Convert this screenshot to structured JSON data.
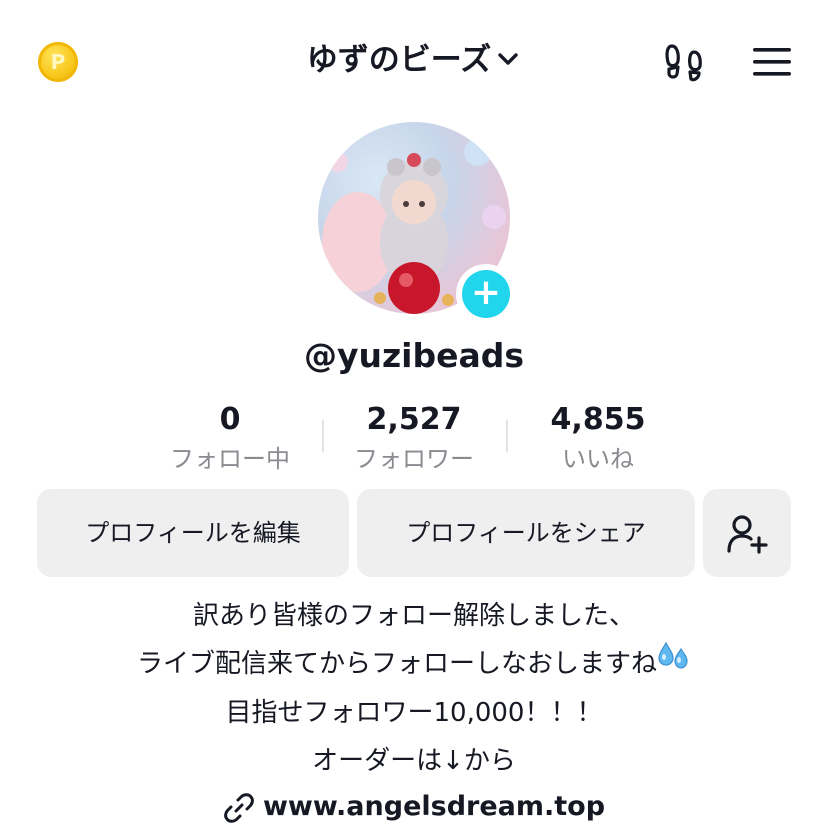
{
  "header": {
    "coin_letter": "P",
    "title": "ゆずのビーズ"
  },
  "profile": {
    "username": "@yuzibeads"
  },
  "stats": [
    {
      "value": "0",
      "label": "フォロー中"
    },
    {
      "value": "2,527",
      "label": "フォロワー"
    },
    {
      "value": "4,855",
      "label": "いいね"
    }
  ],
  "buttons": {
    "edit_profile": "プロフィールを編集",
    "share_profile": "プロフィールをシェア"
  },
  "bio": {
    "line1": "訳あり皆様のフォロー解除しました、",
    "line2": "ライブ配信来てからフォローしなおしますね",
    "line3": "目指せフォロワー10,000！！！",
    "line4": "オーダーは↓から"
  },
  "link": {
    "text": "www.angelsdream.top"
  },
  "colors": {
    "accent": "#20d5ec",
    "coin": "#f8c81c",
    "button_bg": "#efefef",
    "muted_text": "#8a8b91"
  },
  "icons": {
    "coin": "coin-icon",
    "dropdown": "chevron-down-icon",
    "footprint": "footprint-icon",
    "menu": "hamburger-menu-icon",
    "add_avatar": "plus-icon",
    "add_friend": "add-person-icon",
    "droplets": "sweat-droplets-emoji",
    "link": "link-icon"
  }
}
